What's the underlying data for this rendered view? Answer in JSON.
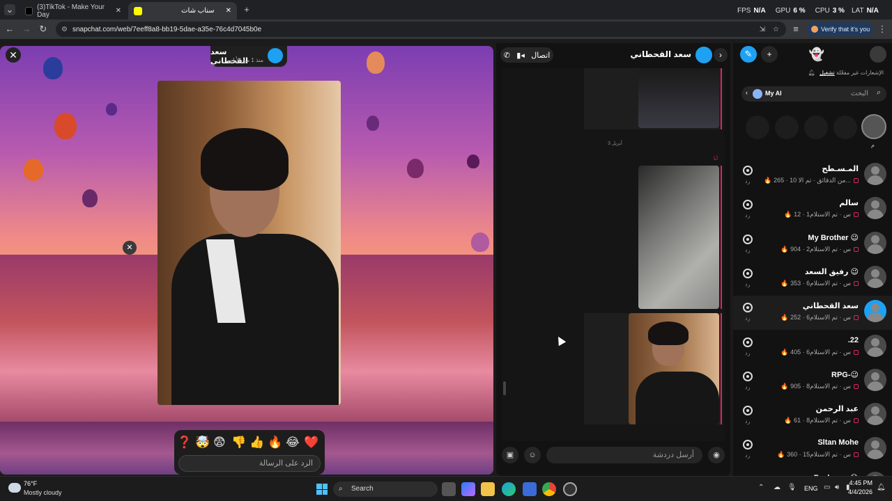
{
  "browser": {
    "tabs": [
      {
        "title": "(3)TikTok - Make Your Day",
        "active": false
      },
      {
        "title": "سناب شات",
        "active": true
      }
    ],
    "new_tab": "+",
    "url": "snapchat.com/web/7eeff8a8-bb19-5dae-a35e-76c4d7045b0e",
    "verify_label": "Verify that it's you",
    "perf": {
      "fps_label": "FPS",
      "fps": "N/A",
      "gpu_label": "GPU",
      "gpu": "6 %",
      "cpu_label": "CPU",
      "cpu": "3 %",
      "lat_label": "LAT",
      "lat": "N/A"
    }
  },
  "viewer": {
    "sender_name": "سعد القحطاني",
    "sender_time": "منذ 1 من الأيام",
    "close": "✕",
    "photo_close": "✕",
    "reactions": [
      "❓",
      "🤯",
      "😨",
      "👎",
      "👍",
      "🔥",
      "😂",
      "❤️"
    ],
    "reply_placeholder": "الرد على الرسالة"
  },
  "chat": {
    "title": "سعد القحطاني",
    "call_label": "اتصال",
    "date_divider": "3 أبريل",
    "me_label": "أنا",
    "message_placeholder": "أرسل دردشة"
  },
  "sidebar": {
    "notifications_text": "الإشعارات غير مفعّلة",
    "notifications_enable": "تشغيل",
    "search_placeholder": "البحث",
    "my_ai_label": "My AI",
    "story_label": "م",
    "friends": [
      {
        "name": "المـسـطح",
        "status": "تم الا...",
        "time": "10 من الدقائق",
        "streak": "265"
      },
      {
        "name": "سالم",
        "status": "تم الاستلام",
        "time": "1س",
        "streak": "12"
      },
      {
        "name": "My Brother 😉",
        "status": "تم الاستلام",
        "time": "2س",
        "streak": "904"
      },
      {
        "name": "رفيق السعد 😉",
        "status": "تم الاستلام",
        "time": "6س",
        "streak": "353"
      },
      {
        "name": "سعد القحطاني",
        "status": "تم الاستلام",
        "time": "6س",
        "streak": "252"
      },
      {
        "name": ".22",
        "status": "تم الاستلام",
        "time": "6س",
        "streak": "405"
      },
      {
        "name": "RPG-😉",
        "status": "تم الاستلام",
        "time": "8س",
        "streak": "905"
      },
      {
        "name": "عبد الرحمن",
        "status": "تم الاستلام",
        "time": "8س",
        "streak": "61"
      },
      {
        "name": "Sltan Mohe",
        "status": "تم الاستلام",
        "time": "15س",
        "streak": "360"
      },
      {
        "name": "Fuck you 😭",
        "status": "",
        "time": "",
        "streak": ""
      }
    ],
    "reply_label": "رد"
  },
  "taskbar": {
    "weather_temp": "76°F",
    "weather_desc": "Mostly cloudy",
    "search_label": "Search",
    "lang": "ENG",
    "time": "4:45 PM",
    "date": "4/4/2026"
  },
  "colors": {
    "accent": "#1ea1f2",
    "streak": "#e0245e",
    "snap_red": "#e0245e"
  }
}
